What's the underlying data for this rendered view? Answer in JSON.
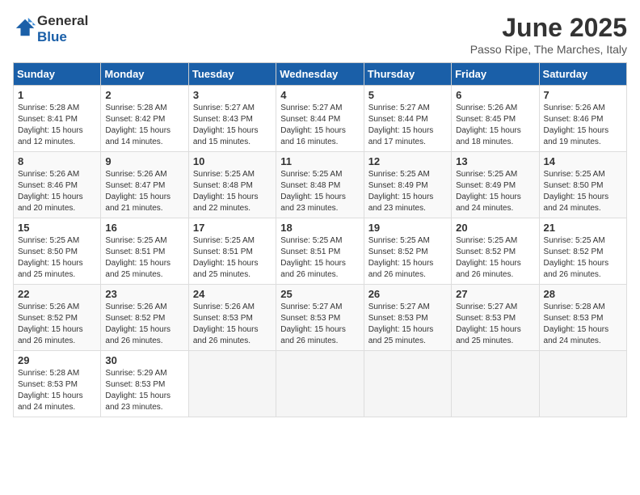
{
  "logo": {
    "general": "General",
    "blue": "Blue"
  },
  "title": "June 2025",
  "location": "Passo Ripe, The Marches, Italy",
  "headers": [
    "Sunday",
    "Monday",
    "Tuesday",
    "Wednesday",
    "Thursday",
    "Friday",
    "Saturday"
  ],
  "weeks": [
    [
      {
        "day": "1",
        "info": "Sunrise: 5:28 AM\nSunset: 8:41 PM\nDaylight: 15 hours\nand 12 minutes."
      },
      {
        "day": "2",
        "info": "Sunrise: 5:28 AM\nSunset: 8:42 PM\nDaylight: 15 hours\nand 14 minutes."
      },
      {
        "day": "3",
        "info": "Sunrise: 5:27 AM\nSunset: 8:43 PM\nDaylight: 15 hours\nand 15 minutes."
      },
      {
        "day": "4",
        "info": "Sunrise: 5:27 AM\nSunset: 8:44 PM\nDaylight: 15 hours\nand 16 minutes."
      },
      {
        "day": "5",
        "info": "Sunrise: 5:27 AM\nSunset: 8:44 PM\nDaylight: 15 hours\nand 17 minutes."
      },
      {
        "day": "6",
        "info": "Sunrise: 5:26 AM\nSunset: 8:45 PM\nDaylight: 15 hours\nand 18 minutes."
      },
      {
        "day": "7",
        "info": "Sunrise: 5:26 AM\nSunset: 8:46 PM\nDaylight: 15 hours\nand 19 minutes."
      }
    ],
    [
      {
        "day": "8",
        "info": "Sunrise: 5:26 AM\nSunset: 8:46 PM\nDaylight: 15 hours\nand 20 minutes."
      },
      {
        "day": "9",
        "info": "Sunrise: 5:26 AM\nSunset: 8:47 PM\nDaylight: 15 hours\nand 21 minutes."
      },
      {
        "day": "10",
        "info": "Sunrise: 5:25 AM\nSunset: 8:48 PM\nDaylight: 15 hours\nand 22 minutes."
      },
      {
        "day": "11",
        "info": "Sunrise: 5:25 AM\nSunset: 8:48 PM\nDaylight: 15 hours\nand 23 minutes."
      },
      {
        "day": "12",
        "info": "Sunrise: 5:25 AM\nSunset: 8:49 PM\nDaylight: 15 hours\nand 23 minutes."
      },
      {
        "day": "13",
        "info": "Sunrise: 5:25 AM\nSunset: 8:49 PM\nDaylight: 15 hours\nand 24 minutes."
      },
      {
        "day": "14",
        "info": "Sunrise: 5:25 AM\nSunset: 8:50 PM\nDaylight: 15 hours\nand 24 minutes."
      }
    ],
    [
      {
        "day": "15",
        "info": "Sunrise: 5:25 AM\nSunset: 8:50 PM\nDaylight: 15 hours\nand 25 minutes."
      },
      {
        "day": "16",
        "info": "Sunrise: 5:25 AM\nSunset: 8:51 PM\nDaylight: 15 hours\nand 25 minutes."
      },
      {
        "day": "17",
        "info": "Sunrise: 5:25 AM\nSunset: 8:51 PM\nDaylight: 15 hours\nand 25 minutes."
      },
      {
        "day": "18",
        "info": "Sunrise: 5:25 AM\nSunset: 8:51 PM\nDaylight: 15 hours\nand 26 minutes."
      },
      {
        "day": "19",
        "info": "Sunrise: 5:25 AM\nSunset: 8:52 PM\nDaylight: 15 hours\nand 26 minutes."
      },
      {
        "day": "20",
        "info": "Sunrise: 5:25 AM\nSunset: 8:52 PM\nDaylight: 15 hours\nand 26 minutes."
      },
      {
        "day": "21",
        "info": "Sunrise: 5:25 AM\nSunset: 8:52 PM\nDaylight: 15 hours\nand 26 minutes."
      }
    ],
    [
      {
        "day": "22",
        "info": "Sunrise: 5:26 AM\nSunset: 8:52 PM\nDaylight: 15 hours\nand 26 minutes."
      },
      {
        "day": "23",
        "info": "Sunrise: 5:26 AM\nSunset: 8:52 PM\nDaylight: 15 hours\nand 26 minutes."
      },
      {
        "day": "24",
        "info": "Sunrise: 5:26 AM\nSunset: 8:53 PM\nDaylight: 15 hours\nand 26 minutes."
      },
      {
        "day": "25",
        "info": "Sunrise: 5:27 AM\nSunset: 8:53 PM\nDaylight: 15 hours\nand 26 minutes."
      },
      {
        "day": "26",
        "info": "Sunrise: 5:27 AM\nSunset: 8:53 PM\nDaylight: 15 hours\nand 25 minutes."
      },
      {
        "day": "27",
        "info": "Sunrise: 5:27 AM\nSunset: 8:53 PM\nDaylight: 15 hours\nand 25 minutes."
      },
      {
        "day": "28",
        "info": "Sunrise: 5:28 AM\nSunset: 8:53 PM\nDaylight: 15 hours\nand 24 minutes."
      }
    ],
    [
      {
        "day": "29",
        "info": "Sunrise: 5:28 AM\nSunset: 8:53 PM\nDaylight: 15 hours\nand 24 minutes."
      },
      {
        "day": "30",
        "info": "Sunrise: 5:29 AM\nSunset: 8:53 PM\nDaylight: 15 hours\nand 23 minutes."
      },
      null,
      null,
      null,
      null,
      null
    ]
  ]
}
